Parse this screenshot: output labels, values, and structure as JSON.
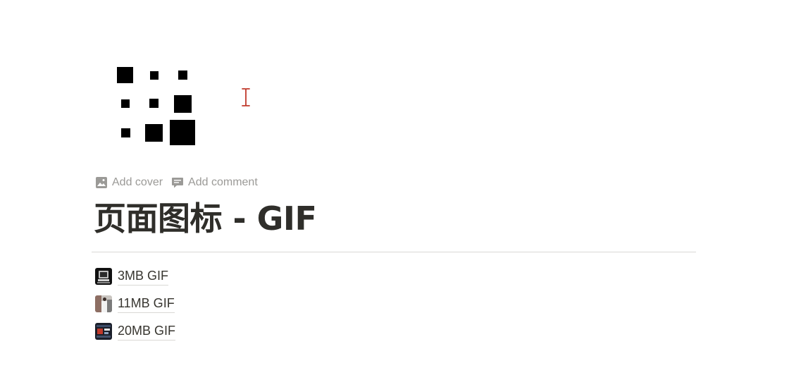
{
  "page": {
    "title": "页面图标 - GIF",
    "icon": "animated-squares-gif-icon"
  },
  "controls": {
    "add_cover_label": "Add cover",
    "add_cover_icon": "image-icon",
    "add_comment_label": "Add comment",
    "add_comment_icon": "comment-icon"
  },
  "links": [
    {
      "label": "3MB GIF",
      "icon": "computer-gif-thumbnail"
    },
    {
      "label": "11MB GIF",
      "icon": "people-gif-thumbnail"
    },
    {
      "label": "20MB GIF",
      "icon": "dashboard-gif-thumbnail"
    }
  ],
  "colors": {
    "text": "#37352f",
    "muted": "#9b9a97",
    "divider": "#d9d8d5",
    "cursor": "#c0392b"
  }
}
